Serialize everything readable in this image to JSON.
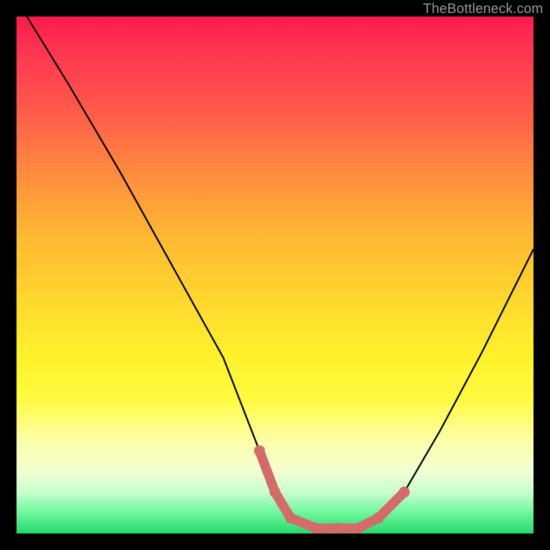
{
  "watermark": "TheBottleneck.com",
  "chart_data": {
    "type": "line",
    "title": "",
    "xlabel": "",
    "ylabel": "",
    "xlim": [
      0,
      100
    ],
    "ylim": [
      0,
      100
    ],
    "series": [
      {
        "name": "bottleneck-curve",
        "x": [
          2,
          10,
          20,
          30,
          40,
          47,
          50,
          53,
          58,
          62,
          66,
          70,
          75,
          82,
          90,
          100
        ],
        "y": [
          100,
          87,
          70,
          52,
          34,
          16,
          8,
          3,
          1,
          1,
          1,
          3,
          8,
          20,
          35,
          55
        ]
      }
    ],
    "highlight": {
      "name": "optimal-zone",
      "color": "#d46a6a",
      "points": [
        {
          "x": 47,
          "y": 16
        },
        {
          "x": 50,
          "y": 8
        },
        {
          "x": 53,
          "y": 3
        },
        {
          "x": 58,
          "y": 1
        },
        {
          "x": 62,
          "y": 1
        },
        {
          "x": 66,
          "y": 1
        },
        {
          "x": 70,
          "y": 3
        },
        {
          "x": 75,
          "y": 8
        }
      ]
    }
  }
}
